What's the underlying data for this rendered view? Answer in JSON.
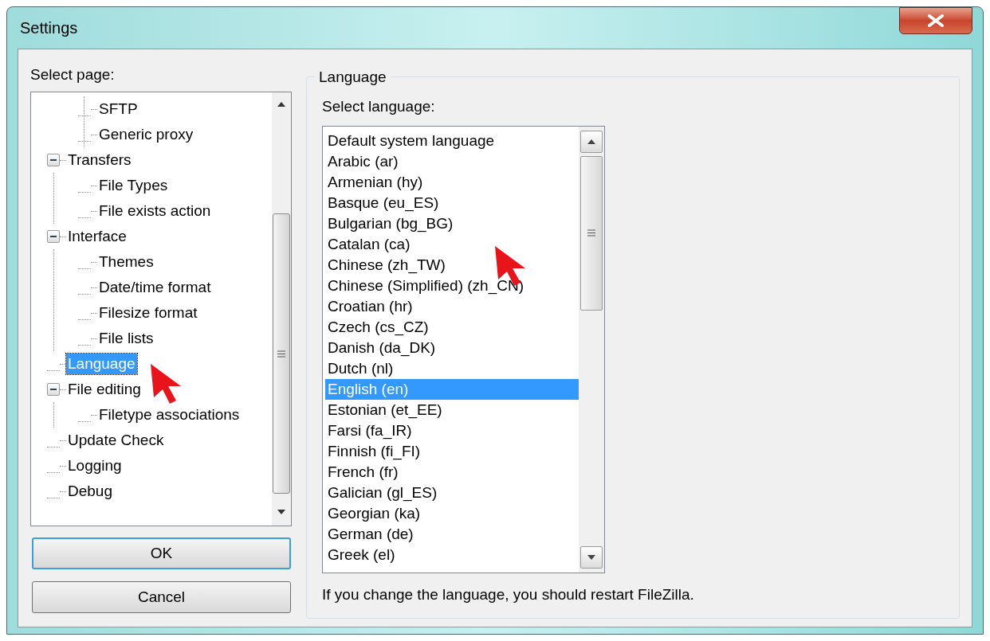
{
  "window": {
    "title": "Settings"
  },
  "page_selector": {
    "label": "Select page:",
    "tree": [
      {
        "children": [
          {
            "label": "SFTP",
            "selected": false
          },
          {
            "label": "Generic proxy",
            "selected": false
          }
        ]
      },
      {
        "label": "Transfers",
        "selected": false,
        "expanded": true,
        "children": [
          {
            "label": "File Types",
            "selected": false
          },
          {
            "label": "File exists action",
            "selected": false
          }
        ]
      },
      {
        "label": "Interface",
        "selected": false,
        "expanded": true,
        "children": [
          {
            "label": "Themes",
            "selected": false
          },
          {
            "label": "Date/time format",
            "selected": false
          },
          {
            "label": "Filesize format",
            "selected": false
          },
          {
            "label": "File lists",
            "selected": false
          }
        ]
      },
      {
        "label": "Language",
        "selected": true
      },
      {
        "label": "File editing",
        "selected": false,
        "expanded": true,
        "children": [
          {
            "label": "Filetype associations",
            "selected": false
          }
        ]
      },
      {
        "label": "Update Check",
        "selected": false
      },
      {
        "label": "Logging",
        "selected": false
      },
      {
        "label": "Debug",
        "selected": false
      }
    ]
  },
  "buttons": [
    {
      "label": "OK",
      "default": true
    },
    {
      "label": "Cancel",
      "default": false
    }
  ],
  "language_group": {
    "title": "Language",
    "list_label": "Select language:",
    "languages": [
      {
        "label": "Default system language",
        "selected": false
      },
      {
        "label": "Arabic (ar)",
        "selected": false
      },
      {
        "label": "Armenian (hy)",
        "selected": false
      },
      {
        "label": "Basque (eu_ES)",
        "selected": false
      },
      {
        "label": "Bulgarian (bg_BG)",
        "selected": false
      },
      {
        "label": "Catalan (ca)",
        "selected": false
      },
      {
        "label": "Chinese (zh_TW)",
        "selected": false
      },
      {
        "label": "Chinese (Simplified) (zh_CN)",
        "selected": false
      },
      {
        "label": "Croatian (hr)",
        "selected": false
      },
      {
        "label": "Czech (cs_CZ)",
        "selected": false
      },
      {
        "label": "Danish (da_DK)",
        "selected": false
      },
      {
        "label": "Dutch (nl)",
        "selected": false
      },
      {
        "label": "English (en)",
        "selected": true
      },
      {
        "label": "Estonian (et_EE)",
        "selected": false
      },
      {
        "label": "Farsi (fa_IR)",
        "selected": false
      },
      {
        "label": "Finnish (fi_FI)",
        "selected": false
      },
      {
        "label": "French (fr)",
        "selected": false
      },
      {
        "label": "Galician (gl_ES)",
        "selected": false
      },
      {
        "label": "Georgian (ka)",
        "selected": false
      },
      {
        "label": "German (de)",
        "selected": false
      },
      {
        "label": "Greek (el)",
        "selected": false
      }
    ],
    "note": "If you change the language, you should restart FileZilla."
  }
}
